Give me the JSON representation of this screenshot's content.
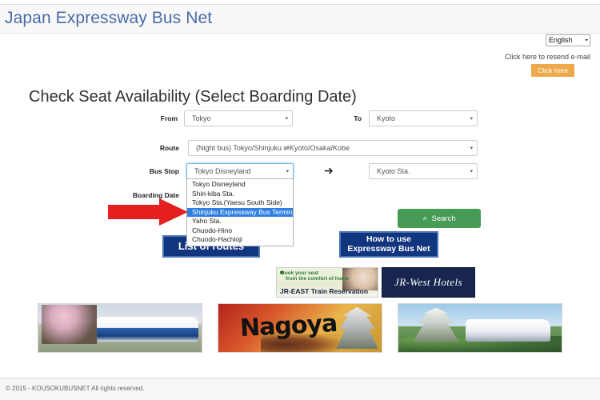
{
  "header": {
    "brand": "Japan Expressway Bus Net"
  },
  "language": {
    "selected": "English",
    "caret": "▾"
  },
  "resend": {
    "text": "Click here to resend e-mail",
    "button_label": "Click here"
  },
  "main": {
    "heading": "Check Seat Availability (Select Boarding Date)",
    "arrow_glyph": "➔",
    "fields": {
      "from_label": "From",
      "from_value": "Tokyo",
      "to_label": "To",
      "to_value": "Kyoto",
      "route_label": "Route",
      "route_value": "(Night bus) Tokyo/Shinjuku ⇌Kyoto/Osaka/Kobe",
      "busstop_label": "Bus Stop",
      "busstop_value": "Tokyo Disneyland",
      "arrival_value": "Kyoto Sta.",
      "boarding_date_label": "Boarding Date",
      "caret": "▾"
    },
    "busstop_options": [
      {
        "label": "Tokyo Disneyland",
        "selected": false
      },
      {
        "label": "Shin-kiba Sta.",
        "selected": false
      },
      {
        "label": "Tokyo Sta.(Yaesu South Side)",
        "selected": false
      },
      {
        "label": "Shinjuku Expressway Bus Terminal",
        "selected": true
      },
      {
        "label": "Yaho Sta.",
        "selected": false
      },
      {
        "label": "Chuodo-Hino",
        "selected": false
      },
      {
        "label": "Chuodo-Hachioji",
        "selected": false
      }
    ],
    "search_button": {
      "label": "Search",
      "icon": "search-icon",
      "glyph": "⌕"
    },
    "nav_buttons": {
      "routes": "List of routes",
      "howto_line1": "How to use",
      "howto_line2": "Expressway Bus Net"
    }
  },
  "ads": {
    "jr_east": {
      "line1": "Book your seat",
      "line2": "from the comfort of home",
      "line3": "JR-EAST Train Reservation"
    },
    "jr_west": {
      "label": "JR-West Hotels"
    },
    "banners": [
      {
        "name": "bus-sakura",
        "caption": ""
      },
      {
        "name": "nagoya",
        "caption": "Nagoya"
      },
      {
        "name": "castle-bus",
        "caption": ""
      }
    ]
  },
  "footer": {
    "copyright": "© 2015 - KOUSOKUBUSNET All rights reserved."
  },
  "colors": {
    "brand_blue": "#4a6ba8",
    "accent_orange": "#eda94a",
    "search_green": "#469b55",
    "nav_blue": "#12357f",
    "highlight_blue": "#2f7fe0",
    "arrow_red": "#e31f20"
  }
}
